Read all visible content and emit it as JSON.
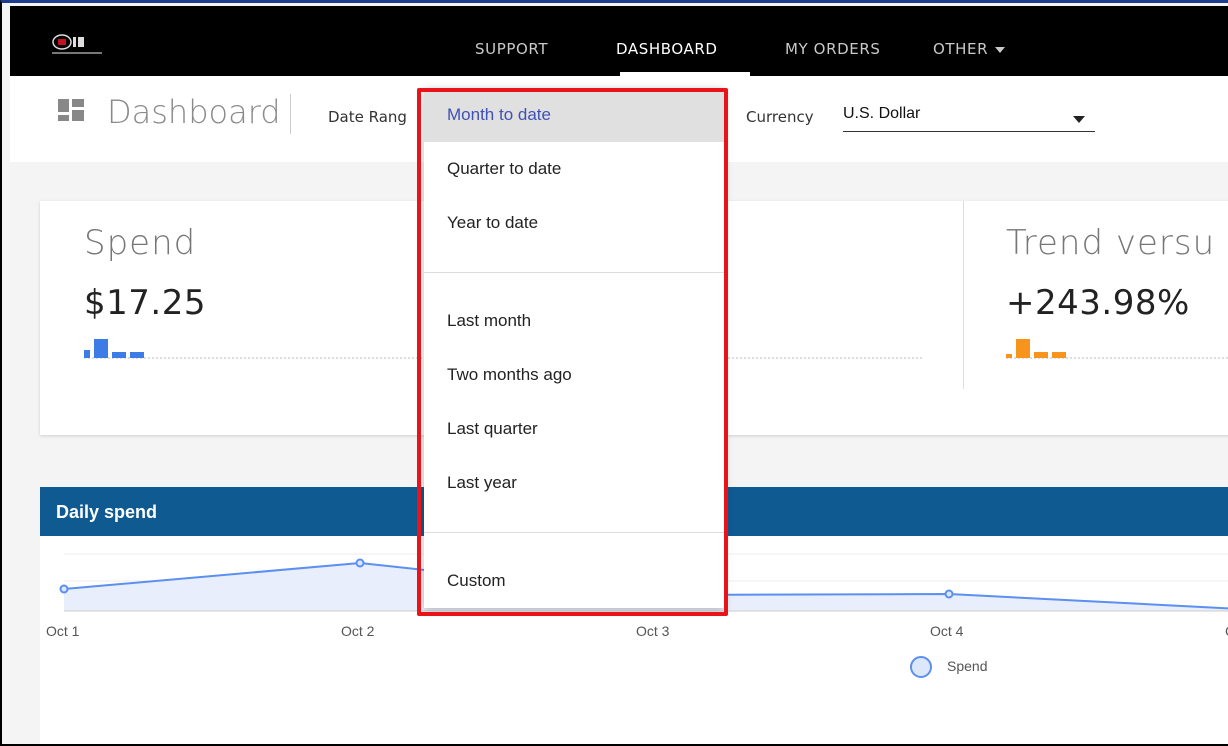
{
  "nav": {
    "links": [
      "SUPPORT",
      "DASHBOARD",
      "MY ORDERS",
      "OTHER"
    ],
    "active": "DASHBOARD"
  },
  "header": {
    "title": "Dashboard",
    "date_range_label": "Date Rang",
    "currency_label": "Currency",
    "currency_value": "U.S. Dollar"
  },
  "kpis": [
    {
      "title": "Spend",
      "value": "$17.25",
      "color": "#3d7be6"
    },
    {
      "title": "Trend versu",
      "value": "+243.98%",
      "color": "#f7941d"
    }
  ],
  "daily_spend": {
    "title": "Daily spend",
    "x_labels": [
      "Oct 1",
      "Oct 2",
      "Oct 3",
      "Oct 4",
      "C"
    ],
    "legend": "Spend",
    "line_color": "#5b8ff0"
  },
  "date_range_dropdown": {
    "options_group1": [
      "Month to date",
      "Quarter to date",
      "Year to date"
    ],
    "options_group2": [
      "Last month",
      "Two months ago",
      "Last quarter",
      "Last year"
    ],
    "options_group3": [
      "Custom"
    ],
    "selected": "Month to date"
  }
}
